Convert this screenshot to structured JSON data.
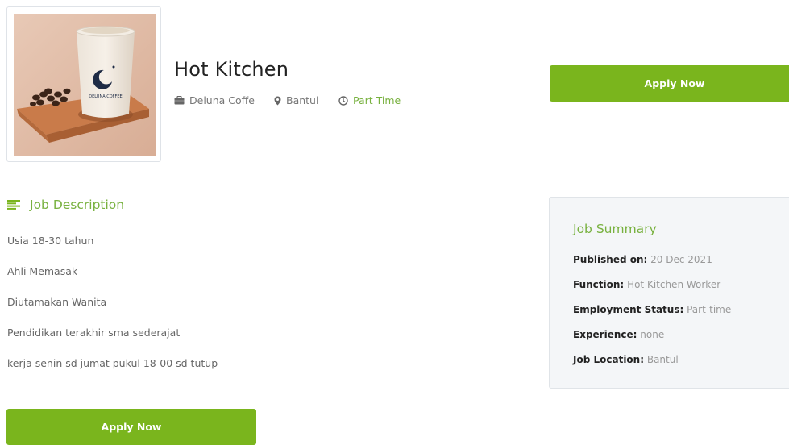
{
  "job": {
    "title": "Hot Kitchen",
    "company": "Deluna Coffe",
    "location": "Bantul",
    "type": "Part Time"
  },
  "image": {
    "cup_text": "DELUNA COFFEE"
  },
  "buttons": {
    "apply_top": "Apply Now",
    "apply_bottom": "Apply Now"
  },
  "description": {
    "heading": "Job Description",
    "lines": [
      "Usia 18-30 tahun",
      "Ahli Memasak",
      "Diutamakan Wanita",
      "Pendidikan terakhir sma sederajat",
      "kerja senin sd jumat pukul 18-00 sd tutup"
    ]
  },
  "summary": {
    "heading": "Job Summary",
    "rows": [
      {
        "label": "Published on:",
        "value": "20 Dec 2021"
      },
      {
        "label": "Function:",
        "value": "Hot Kitchen Worker"
      },
      {
        "label": "Employment Status:",
        "value": "Part-time"
      },
      {
        "label": "Experience:",
        "value": "none"
      },
      {
        "label": "Job Location:",
        "value": "Bantul"
      }
    ]
  },
  "colors": {
    "accent": "#7ab51d",
    "accent_text": "#78b13f"
  },
  "icons": {
    "company": "briefcase-icon",
    "location": "map-pin-icon",
    "type": "clock-icon",
    "description": "align-left-icon"
  }
}
